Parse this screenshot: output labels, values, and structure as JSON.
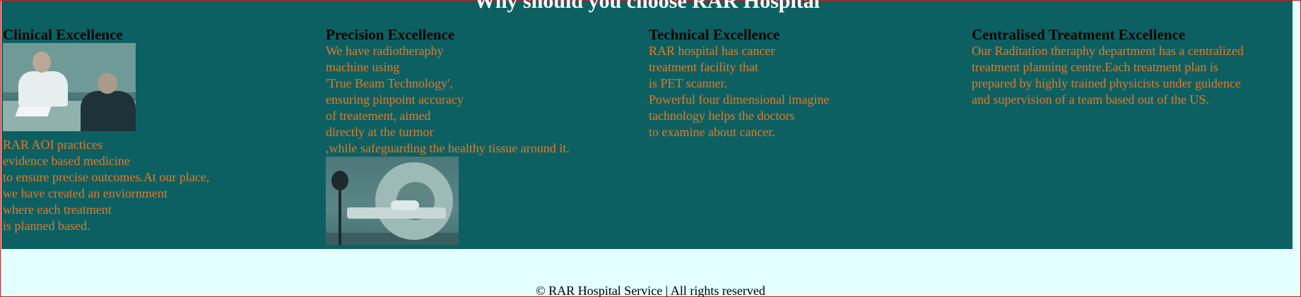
{
  "section": {
    "title": "Why should you choose RAR Hospital"
  },
  "columns": [
    {
      "heading": "Clinical Excellence",
      "image_alt": "doctor-consultation-photo",
      "lines": [
        "RAR AOI practices",
        "evidence based medicine",
        "to ensure precise outcomes.At our place,",
        "we have created an enviornment",
        "where each treatment",
        "is planned based."
      ]
    },
    {
      "heading": "Precision Excellence",
      "image_alt": "mri-machine-photo",
      "lines": [
        "We have radiotheraphy",
        "machine using",
        "'True Beam Technology',",
        "ensuring pinpoint accuracy",
        "of treatement, aimed",
        "directly at the turmor",
        ",while safeguarding the healthy tissue around it."
      ]
    },
    {
      "heading": "Technical Excellence",
      "lines": [
        "RAR hospital has cancer",
        "treatment facility that",
        "is PET scanner.",
        "Powerful four dimensional imagine",
        "tachnology helps the doctors",
        "to examine about cancer."
      ]
    },
    {
      "heading": "Centralised Treatment Excellence",
      "lines": [
        "Our Raditation theraphy department has a centralized",
        "treatment planning centre.Each treatment plan is",
        "prepared by highly trained physicists under guidence",
        "and supervision of a team based out of the US."
      ]
    }
  ],
  "footer": {
    "text": "© RAR Hospital Service | All rights reserved"
  },
  "colors": {
    "section_bg": "#0d6062",
    "body_text": "#e07a2a",
    "page_bg": "#e3ffff",
    "border": "#d11a1a"
  }
}
